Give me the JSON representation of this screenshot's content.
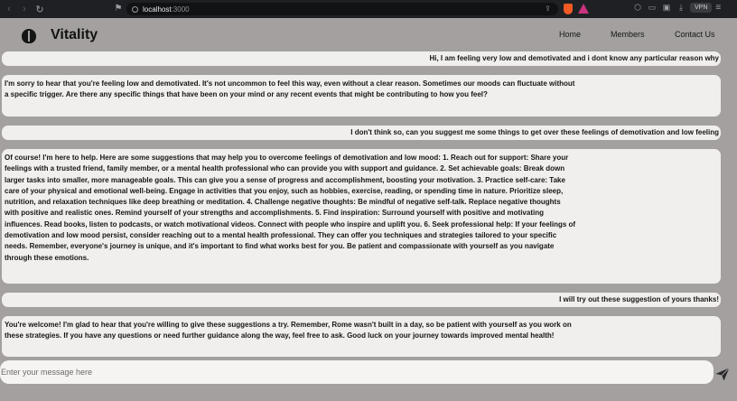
{
  "browser": {
    "url_host": "localhost",
    "url_port": ":3000",
    "vpn_label": "VPN"
  },
  "app": {
    "brand": "Vitality",
    "nav": [
      "Home",
      "Members",
      "Contact Us"
    ]
  },
  "messages": [
    {
      "role": "user",
      "text": "Hi, I am feeling very low and demotivated and i dont know any particular reason why"
    },
    {
      "role": "bot",
      "text": "I'm sorry to hear that you're feeling low and demotivated. It's not uncommon to feel this way, even without a clear reason. Sometimes our moods can fluctuate without a specific trigger. Are there any specific things that have been on your mind or any recent events that might be contributing to how you feel?"
    },
    {
      "role": "user",
      "text": "I don't think so, can you suggest me some things to get over these feelings of demotivation and low feeling"
    },
    {
      "role": "bot",
      "text": "Of course! I'm here to help. Here are some suggestions that may help you to overcome feelings of demotivation and low mood: 1. Reach out for support: Share your feelings with a trusted friend, family member, or a mental health professional who can provide you with support and guidance. 2. Set achievable goals: Break down larger tasks into smaller, more manageable goals. This can give you a sense of progress and accomplishment, boosting your motivation. 3. Practice self-care: Take care of your physical and emotional well-being. Engage in activities that you enjoy, such as hobbies, exercise, reading, or spending time in nature. Prioritize sleep, nutrition, and relaxation techniques like deep breathing or meditation. 4. Challenge negative thoughts: Be mindful of negative self-talk. Replace negative thoughts with positive and realistic ones. Remind yourself of your strengths and accomplishments. 5. Find inspiration: Surround yourself with positive and motivating influences. Read books, listen to podcasts, or watch motivational videos. Connect with people who inspire and uplift you. 6. Seek professional help: If your feelings of demotivation and low mood persist, consider reaching out to a mental health professional. They can offer you techniques and strategies tailored to your specific needs. Remember, everyone's journey is unique, and it's important to find what works best for you. Be patient and compassionate with yourself as you navigate through these emotions."
    },
    {
      "role": "user",
      "text": "I will try out these suggestion of yours thanks!"
    },
    {
      "role": "bot",
      "text": "You're welcome! I'm glad to hear that you're willing to give these suggestions a try. Remember, Rome wasn't built in a day, so be patient with yourself as you work on these strategies. If you have any questions or need further guidance along the way, feel free to ask. Good luck on your journey towards improved mental health!"
    }
  ],
  "composer": {
    "placeholder": "Enter your message here"
  }
}
